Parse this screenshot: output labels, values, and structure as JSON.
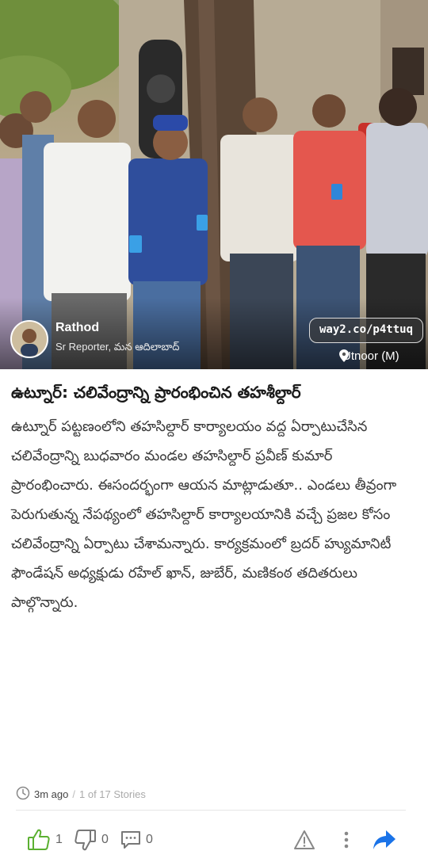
{
  "photo": {
    "reporter": {
      "name": "Rathod",
      "role": "Sr Reporter, మన ఆదిలాబాద్"
    },
    "short_link": "way2.co/p4ttuq",
    "location": "Utnoor (M)"
  },
  "article": {
    "headline": "ఉట్నూర్: చలివేంద్రాన్ని ప్రారంభించిన తహశీల్దార్",
    "body": "ఉట్నూర్ పట్టణంలోని తహసిల్దార్ కార్యాలయం వద్ద ఏర్పాటుచేసిన చలివేంద్రాన్ని బుధవారం మండల తహసిల్దార్ ప్రవీణ్ కుమార్ ప్రారంభించారు. ఈసందర్భంగా ఆయన మాట్లాడుతూ.. ఎండలు తీవ్రంగా పెరుగుతున్న నేపథ్యంలో తహసిల్దార్ కార్యాలయానికి వచ్చే ప్రజల కోసం చలివేంద్రాన్ని ఏర్పాటు చేశామన్నారు. కార్యక్రమంలో బ్రదర్ హ్యుమానిటీ ఫౌండేషన్ అధ్యక్షుడు రహేల్  ఖాన్, జుబేర్, మణికంఠ తదితరులు పాల్గొన్నారు."
  },
  "meta": {
    "time": "3m ago",
    "separator": "/",
    "story_count": "1 of 17 Stories"
  },
  "actions": {
    "like_count": "1",
    "dislike_count": "0",
    "comment_count": "0"
  },
  "icons": {
    "time": "clock-icon",
    "like": "thumbs-up-icon",
    "dislike": "thumbs-down-icon",
    "comment": "comment-icon",
    "report": "warning-icon",
    "more": "more-vertical-icon",
    "share": "share-arrow-icon",
    "location": "location-pin-icon"
  },
  "colors": {
    "like_green": "#5bb031",
    "share_blue": "#1a73e8",
    "text": "#3a3a3a"
  }
}
